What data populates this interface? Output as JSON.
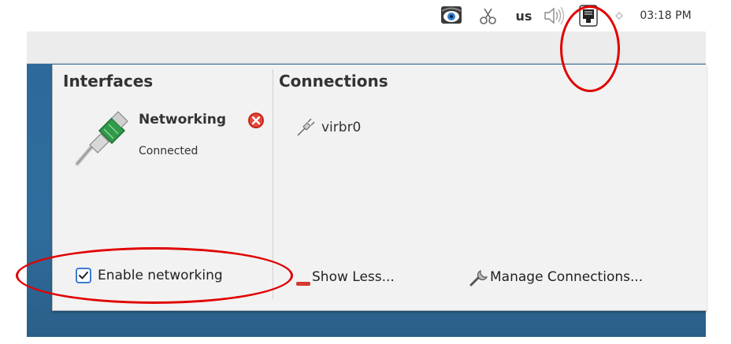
{
  "tray": {
    "keyboard_layout": "us",
    "clock": "03:18 PM",
    "icons": [
      "display-eye-icon",
      "scissors-icon",
      "volume-icon",
      "network-wired-icon",
      "arrow-icon"
    ]
  },
  "panel": {
    "interfaces_heading": "Interfaces",
    "connections_heading": "Connections",
    "interface": {
      "name": "Networking",
      "status": "Connected",
      "status_icon": "error-icon"
    },
    "connections": [
      {
        "name": "virbr0",
        "icon": "plug-icon"
      }
    ],
    "enable_networking": {
      "label": "Enable networking",
      "checked": true
    },
    "show_less_label": "Show Less...",
    "manage_connections_label": "Manage Connections..."
  },
  "colors": {
    "annotation": "#e10000",
    "desktop": "#2d6a9b",
    "checkbox_accent": "#3a7bd5"
  }
}
